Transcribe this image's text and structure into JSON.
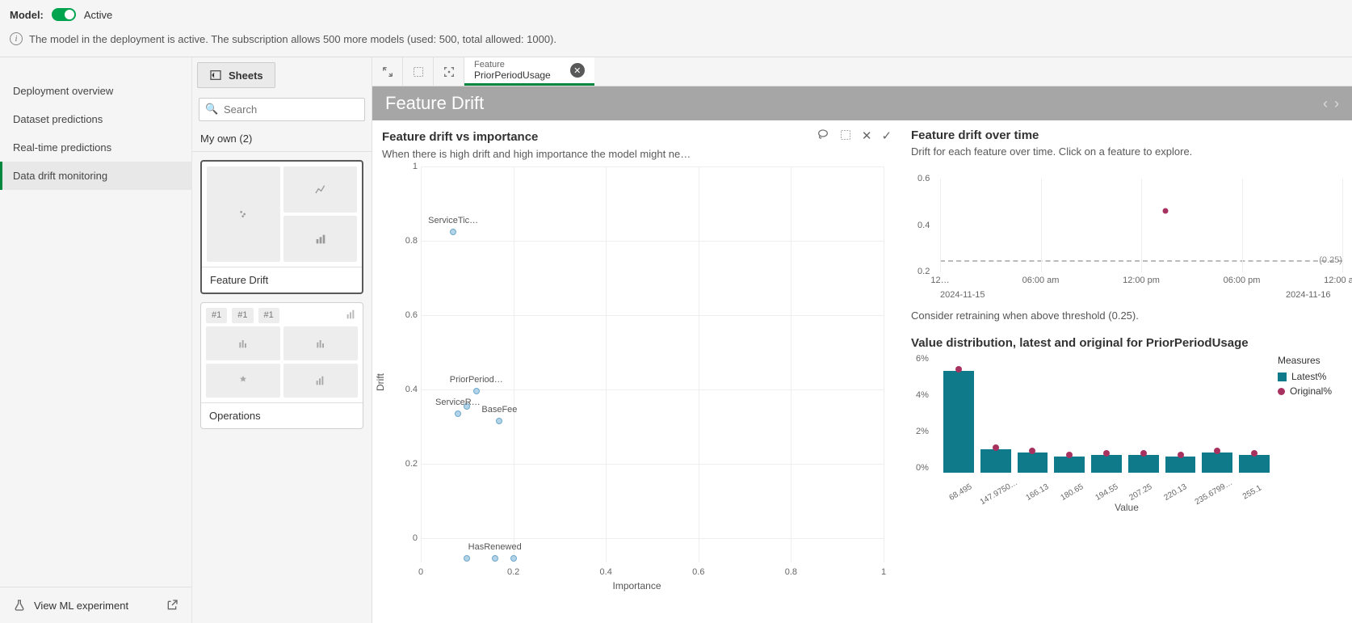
{
  "header": {
    "model_label": "Model:",
    "status": "Active",
    "info": "The model in the deployment is active. The subscription allows 500 more models (used: 500, total allowed: 1000)."
  },
  "sidebar": {
    "items": [
      "Deployment overview",
      "Dataset predictions",
      "Real-time predictions",
      "Data drift monitoring"
    ],
    "footer": "View ML experiment"
  },
  "sheets": {
    "button": "Sheets",
    "search_placeholder": "Search",
    "tab": "My own (2)",
    "card1": "Feature Drift",
    "card2": "Operations",
    "ops_chips": [
      "#1",
      "#1",
      "#1"
    ]
  },
  "tab": {
    "label": "Feature",
    "value": "PriorPeriodUsage"
  },
  "titlebar": "Feature Drift",
  "scatter": {
    "title": "Feature drift vs importance",
    "sub": "When there is high drift and high importance the model might ne…",
    "xlabel": "Importance",
    "ylabel": "Drift"
  },
  "line": {
    "title": "Feature drift over time",
    "sub": "Drift for each feature over time. Click on a feature to explore.",
    "note": "Consider retraining when above threshold (0.25).",
    "threshold_label": "(0.25)",
    "dates": [
      "2024-11-15",
      "2024-11-16"
    ]
  },
  "bars_section": {
    "title": "Value distribution, latest and original for PriorPeriodUsage",
    "legend_title": "Measures",
    "legend1": "Latest%",
    "legend2": "Original%",
    "xlabel": "Value"
  },
  "chart_data": [
    {
      "type": "scatter",
      "title": "Feature drift vs importance",
      "xlabel": "Importance",
      "ylabel": "Drift",
      "xlim": [
        0,
        1
      ],
      "ylim": [
        0,
        1
      ],
      "points": [
        {
          "label": "ServiceTic…",
          "x": 0.07,
          "y": 0.89
        },
        {
          "label": "PriorPeriod…",
          "x": 0.12,
          "y": 0.46
        },
        {
          "label": "",
          "x": 0.1,
          "y": 0.42
        },
        {
          "label": "ServiceR…",
          "x": 0.08,
          "y": 0.4
        },
        {
          "label": "BaseFee",
          "x": 0.17,
          "y": 0.38
        },
        {
          "label": "HasRenewed",
          "x": 0.16,
          "y": 0.01
        },
        {
          "label": "",
          "x": 0.1,
          "y": 0.01
        },
        {
          "label": "",
          "x": 0.2,
          "y": 0.01
        }
      ]
    },
    {
      "type": "line",
      "title": "Feature drift over time",
      "ylim": [
        0.2,
        0.6
      ],
      "threshold": 0.25,
      "x_ticks": [
        "12…",
        "06:00 am",
        "12:00 pm",
        "06:00 pm",
        "12:00 am"
      ],
      "series": [
        {
          "name": "PriorPeriodUsage",
          "values": [
            {
              "x": 0.56,
              "y": 0.46
            }
          ]
        }
      ]
    },
    {
      "type": "bar",
      "title": "Value distribution, latest and original for PriorPeriodUsage",
      "ylabel": "%",
      "xlabel": "Value",
      "ylim": [
        0,
        6
      ],
      "categories": [
        "68.495",
        "147.9750…",
        "166.13",
        "180.65",
        "194.55",
        "207.25",
        "220.13",
        "235.6799…",
        "255.1"
      ],
      "series": [
        {
          "name": "Latest%",
          "values": [
            5.6,
            1.3,
            1.1,
            0.9,
            1.0,
            1.0,
            0.9,
            1.1,
            1.0
          ]
        },
        {
          "name": "Original%",
          "values": [
            5.7,
            1.4,
            1.2,
            1.0,
            1.05,
            1.05,
            1.0,
            1.2,
            1.05
          ]
        }
      ]
    }
  ]
}
